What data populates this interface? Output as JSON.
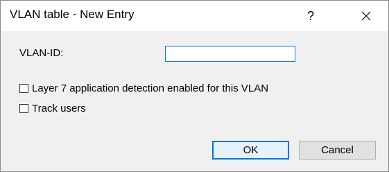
{
  "window": {
    "title": "VLAN table - New Entry",
    "help_label": "?",
    "close_label": "✕"
  },
  "form": {
    "vlan_id_label": "VLAN-ID:",
    "vlan_id_value": "",
    "layer7_label": "Layer 7 application detection enabled for this VLAN",
    "layer7_checked": false,
    "track_users_label": "Track users",
    "track_users_checked": false
  },
  "buttons": {
    "ok_label": "OK",
    "cancel_label": "Cancel"
  },
  "colors": {
    "accent": "#0078d7",
    "dialog_bg": "#f0f0f0"
  }
}
